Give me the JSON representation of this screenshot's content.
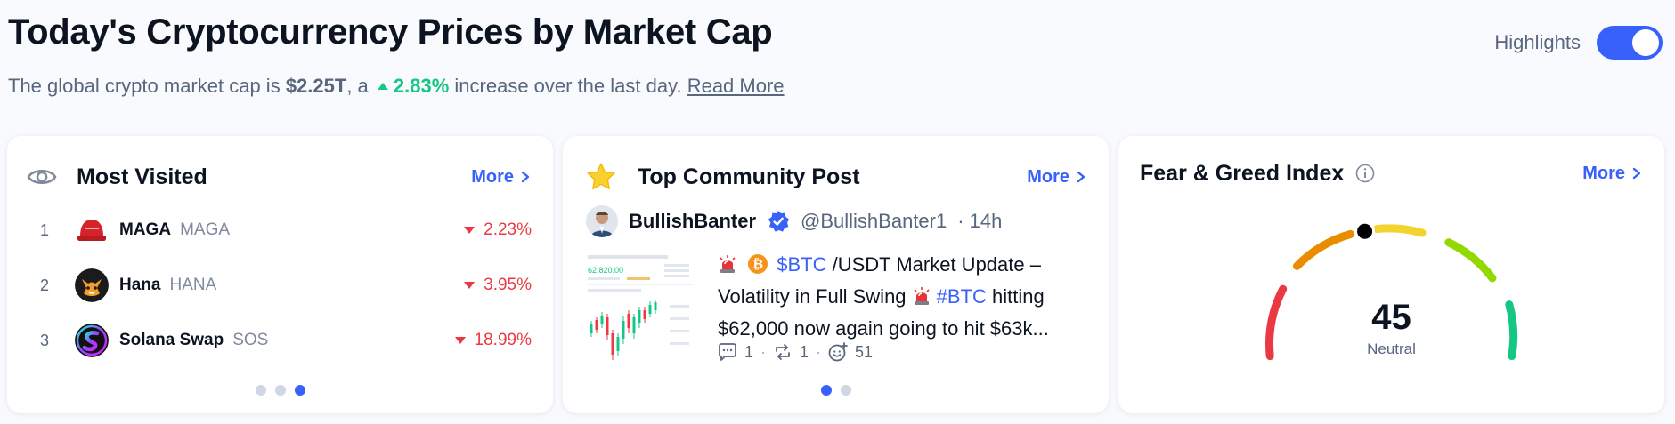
{
  "header": {
    "title": "Today's Cryptocurrency Prices by Market Cap",
    "subtitle_prefix": "The global crypto market cap is ",
    "market_cap": "$2.25T",
    "subtitle_mid": ", a ",
    "change_pct": "2.83%",
    "subtitle_suffix": " increase over the last day.",
    "read_more": "Read More"
  },
  "highlights": {
    "label": "Highlights",
    "enabled": true
  },
  "most_visited": {
    "title": "Most Visited",
    "more": "More",
    "items": [
      {
        "rank": "1",
        "name": "MAGA",
        "symbol": "MAGA",
        "change": "2.23%",
        "direction": "down"
      },
      {
        "rank": "2",
        "name": "Hana",
        "symbol": "HANA",
        "change": "3.95%",
        "direction": "down"
      },
      {
        "rank": "3",
        "name": "Solana Swap",
        "symbol": "SOS",
        "change": "18.99%",
        "direction": "down"
      }
    ],
    "pages": 3,
    "active_page": 3
  },
  "community": {
    "title": "Top Community Post",
    "more": "More",
    "author": "BullishBanter",
    "handle": "@BullishBanter1",
    "time": "· 14h",
    "post": {
      "line_part1": " /USDT Market Update –",
      "cashtag": "$BTC",
      "line_part2": "Volatility in Full Swing ",
      "hashtag": "#BTC",
      "line_part3": " hitting",
      "line_part4": "$62,000 now again going to hit $63k..."
    },
    "thumb": {
      "price": "62,820.00"
    },
    "stats": {
      "comments": "1",
      "reposts": "1",
      "reactions": "51"
    },
    "pages": 2,
    "active_page": 1
  },
  "fear_greed": {
    "title": "Fear & Greed Index",
    "more": "More",
    "value": "45",
    "label": "Neutral",
    "value_numeric": 45
  },
  "colors": {
    "accent": "#3861fb",
    "up": "#16c784",
    "down": "#ea3943"
  }
}
